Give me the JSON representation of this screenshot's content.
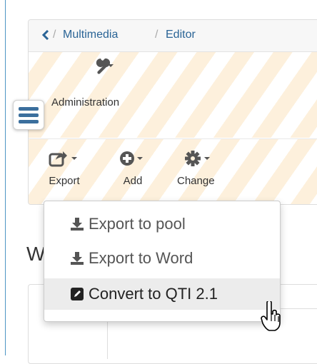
{
  "breadcrumb": {
    "back_icon": "chevron-left-icon",
    "items": [
      "Multimedia",
      "Editor"
    ]
  },
  "toolbar_top": {
    "administration": {
      "icon": "wrench-icon",
      "label": "Administration"
    }
  },
  "toolbar": {
    "export": {
      "icon": "share-icon",
      "label": "Export"
    },
    "add": {
      "icon": "plus-circle-icon",
      "label": "Add"
    },
    "change": {
      "icon": "gear-icon",
      "label": "Change"
    }
  },
  "menu_toggle_icon": "hamburger-icon",
  "heading_partial": "W",
  "export_menu": {
    "items": [
      {
        "icon": "download-icon",
        "label": "Export to pool"
      },
      {
        "icon": "download-icon",
        "label": "Export to Word"
      },
      {
        "icon": "edit-icon",
        "label": "Convert to QTI 2.1",
        "highlighted": true
      }
    ]
  },
  "colors": {
    "link": "#2a6496",
    "stripe": "#fdf0dc",
    "menu_toggle": "#3b6f9d",
    "highlight": "#ececec"
  }
}
